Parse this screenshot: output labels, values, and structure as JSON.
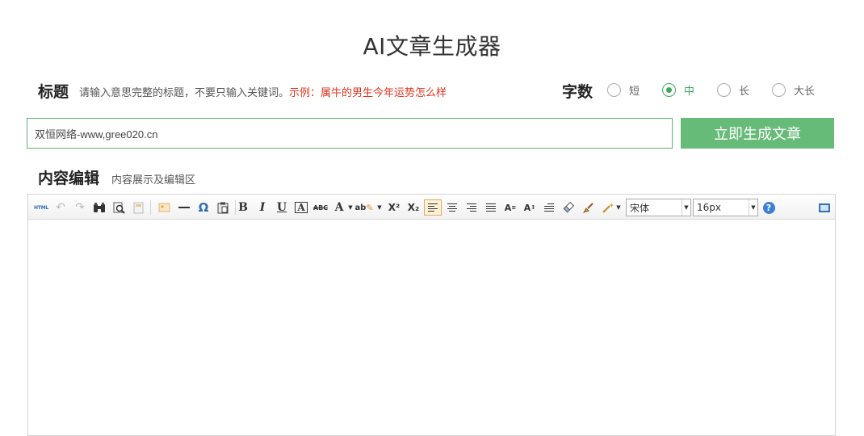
{
  "page": {
    "title": "AI文章生成器"
  },
  "title_row": {
    "label": "标题",
    "hint": "请输入意思完整的标题，不要只输入关键词。",
    "example": "示例：属牛的男生今年运势怎么样"
  },
  "word_count": {
    "label": "字数",
    "options": [
      {
        "label": "短",
        "checked": false
      },
      {
        "label": "中",
        "checked": true
      },
      {
        "label": "长",
        "checked": false
      },
      {
        "label": "大长",
        "checked": false
      }
    ],
    "accent_color": "#3fa85c"
  },
  "title_input": {
    "value": "双恒网络-www,gree020.cn"
  },
  "generate_button": {
    "label": "立即生成文章",
    "color": "#66bb78"
  },
  "content": {
    "label": "内容编辑",
    "sub": "内容展示及编辑区"
  },
  "toolbar": {
    "html_label": "HTML",
    "omega": "Ω",
    "bold": "B",
    "italic": "I",
    "underline": "U",
    "font_border": "A",
    "strike": "ABC",
    "font_color": "A",
    "back_color": "ab",
    "superscript": "X²",
    "subscript": "X₂",
    "font_family": "宋体",
    "font_size": "16px",
    "help": "?",
    "icons": [
      "source-html-icon",
      "undo-icon",
      "redo-icon",
      "find-icon",
      "preview-icon",
      "template-icon",
      "image-icon",
      "horizontal-rule-icon",
      "special-char-icon",
      "paste-icon",
      "bold-icon",
      "italic-icon",
      "underline-icon",
      "font-border-icon",
      "strikethrough-icon",
      "font-color-icon",
      "back-color-icon",
      "superscript-icon",
      "subscript-icon",
      "align-left-icon",
      "align-center-icon",
      "align-right-icon",
      "justify-icon",
      "line-height-icon",
      "letter-spacing-icon",
      "indent-icon",
      "eraser-icon",
      "brush-icon",
      "auto-format-icon",
      "help-icon",
      "fullscreen-icon"
    ]
  }
}
